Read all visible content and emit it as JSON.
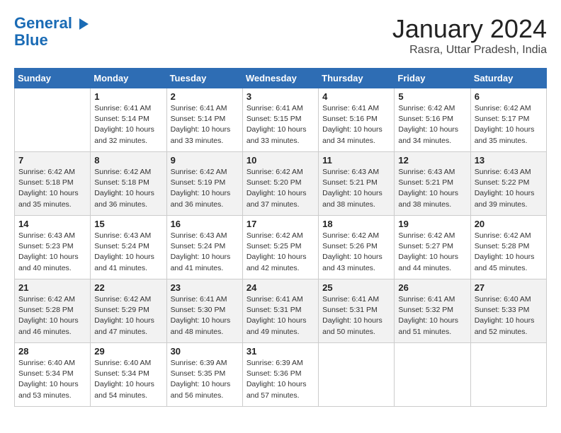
{
  "logo": {
    "line1": "General",
    "line2": "Blue"
  },
  "title": "January 2024",
  "location": "Rasra, Uttar Pradesh, India",
  "days_header": [
    "Sunday",
    "Monday",
    "Tuesday",
    "Wednesday",
    "Thursday",
    "Friday",
    "Saturday"
  ],
  "weeks": [
    [
      {
        "num": "",
        "detail": ""
      },
      {
        "num": "1",
        "detail": "Sunrise: 6:41 AM\nSunset: 5:14 PM\nDaylight: 10 hours\nand 32 minutes."
      },
      {
        "num": "2",
        "detail": "Sunrise: 6:41 AM\nSunset: 5:14 PM\nDaylight: 10 hours\nand 33 minutes."
      },
      {
        "num": "3",
        "detail": "Sunrise: 6:41 AM\nSunset: 5:15 PM\nDaylight: 10 hours\nand 33 minutes."
      },
      {
        "num": "4",
        "detail": "Sunrise: 6:41 AM\nSunset: 5:16 PM\nDaylight: 10 hours\nand 34 minutes."
      },
      {
        "num": "5",
        "detail": "Sunrise: 6:42 AM\nSunset: 5:16 PM\nDaylight: 10 hours\nand 34 minutes."
      },
      {
        "num": "6",
        "detail": "Sunrise: 6:42 AM\nSunset: 5:17 PM\nDaylight: 10 hours\nand 35 minutes."
      }
    ],
    [
      {
        "num": "7",
        "detail": "Sunrise: 6:42 AM\nSunset: 5:18 PM\nDaylight: 10 hours\nand 35 minutes."
      },
      {
        "num": "8",
        "detail": "Sunrise: 6:42 AM\nSunset: 5:18 PM\nDaylight: 10 hours\nand 36 minutes."
      },
      {
        "num": "9",
        "detail": "Sunrise: 6:42 AM\nSunset: 5:19 PM\nDaylight: 10 hours\nand 36 minutes."
      },
      {
        "num": "10",
        "detail": "Sunrise: 6:42 AM\nSunset: 5:20 PM\nDaylight: 10 hours\nand 37 minutes."
      },
      {
        "num": "11",
        "detail": "Sunrise: 6:43 AM\nSunset: 5:21 PM\nDaylight: 10 hours\nand 38 minutes."
      },
      {
        "num": "12",
        "detail": "Sunrise: 6:43 AM\nSunset: 5:21 PM\nDaylight: 10 hours\nand 38 minutes."
      },
      {
        "num": "13",
        "detail": "Sunrise: 6:43 AM\nSunset: 5:22 PM\nDaylight: 10 hours\nand 39 minutes."
      }
    ],
    [
      {
        "num": "14",
        "detail": "Sunrise: 6:43 AM\nSunset: 5:23 PM\nDaylight: 10 hours\nand 40 minutes."
      },
      {
        "num": "15",
        "detail": "Sunrise: 6:43 AM\nSunset: 5:24 PM\nDaylight: 10 hours\nand 41 minutes."
      },
      {
        "num": "16",
        "detail": "Sunrise: 6:43 AM\nSunset: 5:24 PM\nDaylight: 10 hours\nand 41 minutes."
      },
      {
        "num": "17",
        "detail": "Sunrise: 6:42 AM\nSunset: 5:25 PM\nDaylight: 10 hours\nand 42 minutes."
      },
      {
        "num": "18",
        "detail": "Sunrise: 6:42 AM\nSunset: 5:26 PM\nDaylight: 10 hours\nand 43 minutes."
      },
      {
        "num": "19",
        "detail": "Sunrise: 6:42 AM\nSunset: 5:27 PM\nDaylight: 10 hours\nand 44 minutes."
      },
      {
        "num": "20",
        "detail": "Sunrise: 6:42 AM\nSunset: 5:28 PM\nDaylight: 10 hours\nand 45 minutes."
      }
    ],
    [
      {
        "num": "21",
        "detail": "Sunrise: 6:42 AM\nSunset: 5:28 PM\nDaylight: 10 hours\nand 46 minutes."
      },
      {
        "num": "22",
        "detail": "Sunrise: 6:42 AM\nSunset: 5:29 PM\nDaylight: 10 hours\nand 47 minutes."
      },
      {
        "num": "23",
        "detail": "Sunrise: 6:41 AM\nSunset: 5:30 PM\nDaylight: 10 hours\nand 48 minutes."
      },
      {
        "num": "24",
        "detail": "Sunrise: 6:41 AM\nSunset: 5:31 PM\nDaylight: 10 hours\nand 49 minutes."
      },
      {
        "num": "25",
        "detail": "Sunrise: 6:41 AM\nSunset: 5:31 PM\nDaylight: 10 hours\nand 50 minutes."
      },
      {
        "num": "26",
        "detail": "Sunrise: 6:41 AM\nSunset: 5:32 PM\nDaylight: 10 hours\nand 51 minutes."
      },
      {
        "num": "27",
        "detail": "Sunrise: 6:40 AM\nSunset: 5:33 PM\nDaylight: 10 hours\nand 52 minutes."
      }
    ],
    [
      {
        "num": "28",
        "detail": "Sunrise: 6:40 AM\nSunset: 5:34 PM\nDaylight: 10 hours\nand 53 minutes."
      },
      {
        "num": "29",
        "detail": "Sunrise: 6:40 AM\nSunset: 5:34 PM\nDaylight: 10 hours\nand 54 minutes."
      },
      {
        "num": "30",
        "detail": "Sunrise: 6:39 AM\nSunset: 5:35 PM\nDaylight: 10 hours\nand 56 minutes."
      },
      {
        "num": "31",
        "detail": "Sunrise: 6:39 AM\nSunset: 5:36 PM\nDaylight: 10 hours\nand 57 minutes."
      },
      {
        "num": "",
        "detail": ""
      },
      {
        "num": "",
        "detail": ""
      },
      {
        "num": "",
        "detail": ""
      }
    ]
  ]
}
